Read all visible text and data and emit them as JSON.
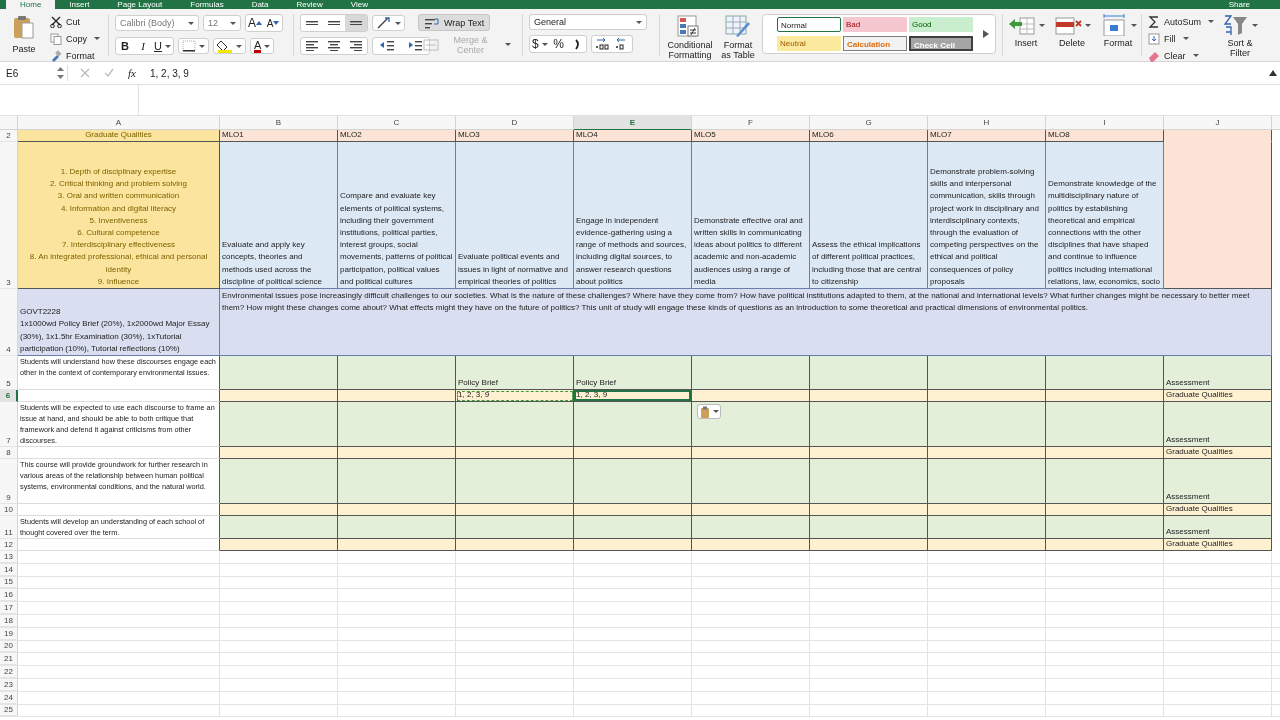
{
  "tabs": [
    {
      "label": "Home",
      "selected": true
    },
    {
      "label": "Insert",
      "selected": false
    },
    {
      "label": "Page Layout",
      "selected": false
    },
    {
      "label": "Formulas",
      "selected": false
    },
    {
      "label": "Data",
      "selected": false
    },
    {
      "label": "Review",
      "selected": false
    },
    {
      "label": "View",
      "selected": false
    }
  ],
  "share": "Share",
  "ribbon": {
    "clipboard": {
      "paste": "Paste",
      "cut": "Cut",
      "copy": "Copy",
      "format": "Format"
    },
    "font": {
      "name": "Calibri (Body)",
      "size": "12",
      "grow": "A",
      "shrink": "A",
      "bold": "B",
      "italic": "I",
      "underline": "U",
      "font_color": "A"
    },
    "alignment": {
      "vertical_align": [
        {
          "selected": false
        },
        {
          "selected": false
        },
        {
          "selected": true
        }
      ],
      "wrap_text": {
        "label": "Wrap Text",
        "on": true
      },
      "merge_center": {
        "label": "Merge & Center",
        "disabled": true
      }
    },
    "number": {
      "format": "General",
      "currency": "$",
      "percent": "%"
    },
    "styles": {
      "conditional": "Conditional Formatting",
      "format_table": "Format as Table",
      "cell_styles": [
        {
          "label": "Normal",
          "kind": "normal",
          "selected": true
        },
        {
          "label": "Bad",
          "kind": "bad",
          "selected": false
        },
        {
          "label": "Good",
          "kind": "good",
          "selected": false
        },
        {
          "label": "Neutral",
          "kind": "neutral",
          "selected": false
        },
        {
          "label": "Calculation",
          "kind": "calculation",
          "selected": false
        },
        {
          "label": "Check Cell",
          "kind": "check",
          "selected": false
        }
      ]
    },
    "cells": {
      "insert": "Insert",
      "delete": "Delete",
      "format": "Format"
    },
    "editing": {
      "autosum": "AutoSum",
      "fill": "Fill",
      "clear": "Clear",
      "sort_filter": "Sort & Filter"
    }
  },
  "formula_bar": {
    "name_box": "E6",
    "fx": "fx",
    "value": "1, 2, 3, 9"
  },
  "sheet": {
    "columns": [
      {
        "label": "A",
        "selected": false
      },
      {
        "label": "B",
        "selected": false
      },
      {
        "label": "C",
        "selected": false
      },
      {
        "label": "D",
        "selected": false
      },
      {
        "label": "E",
        "selected": true
      },
      {
        "label": "F",
        "selected": false
      },
      {
        "label": "G",
        "selected": false
      },
      {
        "label": "H",
        "selected": false
      },
      {
        "label": "I",
        "selected": false
      },
      {
        "label": "J",
        "selected": false
      }
    ],
    "rows": [
      {
        "number": "2",
        "selected": false,
        "kind": "mlo_header",
        "a": "Graduate Qualities",
        "cells": [
          {
            "text": "MLO1"
          },
          {
            "text": "MLO2"
          },
          {
            "text": "MLO3"
          },
          {
            "text": "MLO4"
          },
          {
            "text": "MLO5"
          },
          {
            "text": "MLO6"
          },
          {
            "text": "MLO7"
          },
          {
            "text": "MLO8"
          },
          null
        ]
      },
      {
        "number": "3",
        "selected": false,
        "kind": "mlo_text",
        "a": "1. Depth of disciplinary expertise\n2. Critical thinking and problem solving\n3. Oral and written communication\n4. Information and digital literacy\n5. Inventiveness\n6. Cultural competence\n7. Interdisciplinary effectiveness\n8. An integrated professional, ethical and personal identity\n9. Influence",
        "cells": [
          {
            "text": "Evaluate and apply key concepts, theories and methods used across the discipline of political science"
          },
          {
            "text": "Compare and evaluate key elements of political systems, including their government institutions, political parties, interest groups, social movements, patterns of political participation, political values and political cultures"
          },
          {
            "text": "Evaluate political events and issues in light of normative and empirical theories of politics"
          },
          {
            "text": "Engage in independent evidence-gathering using a range of methods and sources, including digital sources, to answer research questions about politics"
          },
          {
            "text": "Demonstrate effective oral and written skills in communicating ideas about politics to different academic and non-academic audiences using a range of media"
          },
          {
            "text": "Assess the ethical implications of different political practices, including those that are central to citizenship"
          },
          {
            "text": "Demonstrate problem-solving skills and interpersonal communication, skills through project work in disciplinary and interdisciplinary contexts, through the evaluation of competing perspectives on the ethical and political consequences of policy proposals"
          },
          {
            "text": "Demonstrate knowledge of the multidisciplinary nature of politics by establishing theoretical and empirical connections with the other disciplines that have shaped and continue to influence politics including international relations, law, economics, socio"
          },
          null
        ]
      },
      {
        "number": "4",
        "selected": false,
        "kind": "course",
        "a": "GOVT2228\n1x1000wd Policy Brief (20%), 1x2000wd Major Essay (30%), 1x1.5hr Examination (30%), 1xTutorial participation (10%), Tutorial reflections (10%)",
        "merged": "Environmental issues pose increasingly difficult challenges to our societies. What is the nature of these challenges? Where have they come from? How have political institutions adapted to them, at the national and international levels? What further changes might be necessary to better meet them? How might these changes come about? What effects might they have on the future of politics? This unit of study will engage these kinds of questions as an introduction to some theoretical and practical dimensions of environmental politics."
      },
      {
        "number": "5",
        "selected": false,
        "kind": "outcome",
        "a": "Students will understand how these discourses engage each other in the context of contemporary environmental issues.",
        "cells": [
          null,
          null,
          {
            "text": "Policy Brief"
          },
          {
            "text": "Policy Brief"
          },
          null,
          null,
          null,
          null,
          {
            "text": "Assessment"
          }
        ]
      },
      {
        "number": "6",
        "selected": true,
        "kind": "qualities",
        "cells": [
          null,
          null,
          {
            "text": "1, 2, 3, 9",
            "selected": false,
            "copied": true
          },
          {
            "text": "1, 2, 3, 9",
            "selected": true,
            "copied": false
          },
          null,
          null,
          null,
          null,
          {
            "text": "Graduate Qualities"
          }
        ]
      },
      {
        "number": "7",
        "selected": false,
        "kind": "outcome",
        "a": "Students will be expected to use each discourse to frame an issue at hand, and should be able to both critique that framework and defend it against criticisms from other discourses.",
        "cells": [
          null,
          null,
          null,
          null,
          null,
          null,
          null,
          null,
          {
            "text": "Assessment"
          }
        ]
      },
      {
        "number": "8",
        "selected": false,
        "kind": "qualities",
        "cells": [
          null,
          null,
          null,
          null,
          null,
          null,
          null,
          null,
          {
            "text": "Graduate Qualities"
          }
        ]
      },
      {
        "number": "9",
        "selected": false,
        "kind": "outcome",
        "a": "This course will provide groundwork for further research in various areas of the relationship between human political systems, environmental conditions, and the natural world.",
        "cells": [
          null,
          null,
          null,
          null,
          null,
          null,
          null,
          null,
          {
            "text": "Assessment"
          }
        ]
      },
      {
        "number": "10",
        "selected": false,
        "kind": "qualities",
        "cells": [
          null,
          null,
          null,
          null,
          null,
          null,
          null,
          null,
          {
            "text": "Graduate Qualities"
          }
        ]
      },
      {
        "number": "11",
        "selected": false,
        "kind": "outcome",
        "a": "Students will develop an understanding of each school of thought covered over the term.",
        "cells": [
          null,
          null,
          null,
          null,
          null,
          null,
          null,
          null,
          {
            "text": "Assessment"
          }
        ]
      },
      {
        "number": "12",
        "selected": false,
        "kind": "qualities",
        "cells": [
          null,
          null,
          null,
          null,
          null,
          null,
          null,
          null,
          {
            "text": "Graduate Qualities"
          }
        ]
      },
      {
        "number": "13",
        "selected": false,
        "kind": "blank"
      },
      {
        "number": "14",
        "selected": false,
        "kind": "blank"
      },
      {
        "number": "15",
        "selected": false,
        "kind": "blank"
      },
      {
        "number": "16",
        "selected": false,
        "kind": "blank"
      },
      {
        "number": "17",
        "selected": false,
        "kind": "blank"
      },
      {
        "number": "18",
        "selected": false,
        "kind": "blank"
      },
      {
        "number": "19",
        "selected": false,
        "kind": "blank"
      },
      {
        "number": "20",
        "selected": false,
        "kind": "blank"
      },
      {
        "number": "21",
        "selected": false,
        "kind": "blank"
      },
      {
        "number": "22",
        "selected": false,
        "kind": "blank"
      },
      {
        "number": "23",
        "selected": false,
        "kind": "blank"
      },
      {
        "number": "24",
        "selected": false,
        "kind": "blank"
      },
      {
        "number": "25",
        "selected": false,
        "kind": "blank"
      }
    ],
    "paste_options": true
  }
}
